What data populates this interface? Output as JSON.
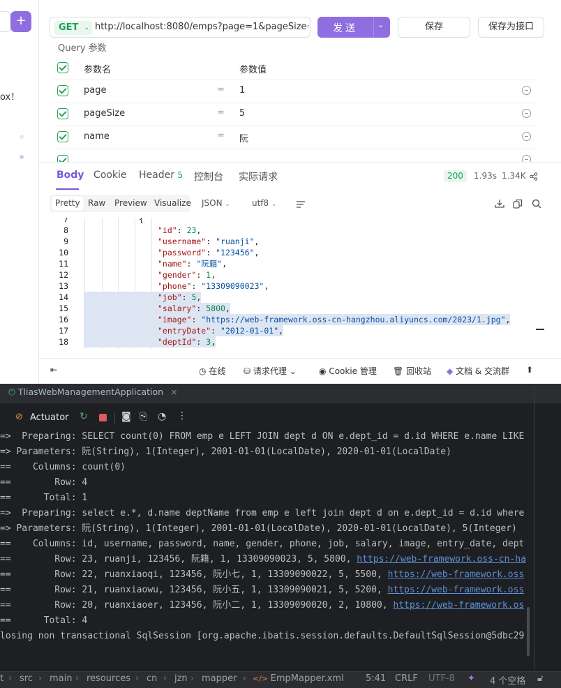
{
  "request": {
    "method": "GET",
    "url": "http://localhost:8080/emps?page=1&pageSize=5",
    "send_label": "发送",
    "save_label": "保存",
    "save_as_label": "保存为接口"
  },
  "left_strip": {
    "partial_text": "ox！"
  },
  "query": {
    "title": "Query 参数",
    "col_name": "参数名",
    "col_value": "参数值",
    "params": [
      {
        "name": "page",
        "value": "1"
      },
      {
        "name": "pageSize",
        "value": "5"
      },
      {
        "name": "name",
        "value": "阮"
      }
    ],
    "eq": "="
  },
  "response": {
    "tabs": [
      {
        "label": "Body"
      },
      {
        "label": "Cookie"
      },
      {
        "label": "Header",
        "count": "5"
      },
      {
        "label": "控制台"
      },
      {
        "label": "实际请求"
      }
    ],
    "status": "200",
    "time": "1.93s",
    "size": "1.34K",
    "formats": [
      "Pretty",
      "Raw",
      "Preview",
      "Visualize"
    ],
    "type": "JSON",
    "encoding": "utf8",
    "code": [
      {
        "ln": "7",
        "text": "{"
      },
      {
        "ln": "8",
        "key": "\"id\"",
        "val": "23",
        "vt": "n"
      },
      {
        "ln": "9",
        "key": "\"username\"",
        "val": "\"ruanji\"",
        "vt": "s"
      },
      {
        "ln": "10",
        "key": "\"password\"",
        "val": "\"123456\"",
        "vt": "s"
      },
      {
        "ln": "11",
        "key": "\"name\"",
        "val": "\"阮籍\"",
        "vt": "s"
      },
      {
        "ln": "12",
        "key": "\"gender\"",
        "val": "1",
        "vt": "n"
      },
      {
        "ln": "13",
        "key": "\"phone\"",
        "val": "\"13309090023\"",
        "vt": "s"
      },
      {
        "ln": "14",
        "key": "\"job\"",
        "val": "5",
        "vt": "n",
        "sel": true
      },
      {
        "ln": "15",
        "key": "\"salary\"",
        "val": "5800",
        "vt": "n",
        "sel": true
      },
      {
        "ln": "16",
        "key": "\"image\"",
        "val": "\"https://web-framework.oss-cn-hangzhou.aliyuncs.com/2023/1.jpg\"",
        "vt": "s",
        "sel": true
      },
      {
        "ln": "17",
        "key": "\"entryDate\"",
        "val": "\"2012-01-01\"",
        "vt": "s",
        "sel": true
      },
      {
        "ln": "18",
        "key": "\"deptId\"",
        "val": "3",
        "vt": "n",
        "sel": true
      }
    ]
  },
  "footer": {
    "online": "在线",
    "proxy": "请求代理",
    "cookie": "Cookie 管理",
    "trash": "回收站",
    "docs": "文档 & 交流群"
  },
  "ide": {
    "run_tab": "TliasWebManagementApplication",
    "actuator": "Actuator",
    "console": [
      "=>  Preparing: SELECT count(0) FROM emp e LEFT JOIN dept d ON e.dept_id = d.id WHERE e.name LIKE",
      "=> Parameters: 阮(String), 1(Integer), 2001-01-01(LocalDate), 2020-01-01(LocalDate)",
      "==    Columns: count(0)",
      "==        Row: 4",
      "==      Total: 1",
      "=>  Preparing: select e.*, d.name deptName from emp e left join dept d on e.dept_id = d.id where",
      "=> Parameters: 阮(String), 1(Integer), 2001-01-01(LocalDate), 2020-01-01(LocalDate), 5(Integer)",
      "==    Columns: id, username, password, name, gender, phone, job, salary, image, entry_date, dept"
    ],
    "rows": [
      {
        "text": "==        Row: 23, ruanji, 123456, 阮籍, 1, 13309090023, 5, 5800, ",
        "link": "https://web-framework.oss-cn-ha"
      },
      {
        "text": "==        Row: 22, ruanxiaoqi, 123456, 阮小七, 1, 13309090022, 5, 5500, ",
        "link": "https://web-framework.oss"
      },
      {
        "text": "==        Row: 21, ruanxiaowu, 123456, 阮小五, 1, 13309090021, 5, 5200, ",
        "link": "https://web-framework.oss"
      },
      {
        "text": "==        Row: 20, ruanxiaoer, 123456, 阮小二, 1, 13309090020, 2, 10800, ",
        "link": "https://web-framework.os"
      }
    ],
    "console_tail": [
      "==      Total: 4",
      "losing non transactional SqlSession [org.apache.ibatis.session.defaults.DefaultSqlSession@5dbc29"
    ],
    "status": {
      "breadcrumb": [
        "t",
        "src",
        "main",
        "resources",
        "cn",
        "jzn",
        "mapper",
        "EmpMapper.xml"
      ],
      "position": "5:41",
      "line_sep": "CRLF",
      "encoding": "UTF-8",
      "indent": "4 个空格"
    }
  },
  "colors": {
    "accent": "#7a55d8",
    "send_button": "#8f6ee0",
    "success": "#18a058",
    "ide_bg": "#1e1f22"
  }
}
